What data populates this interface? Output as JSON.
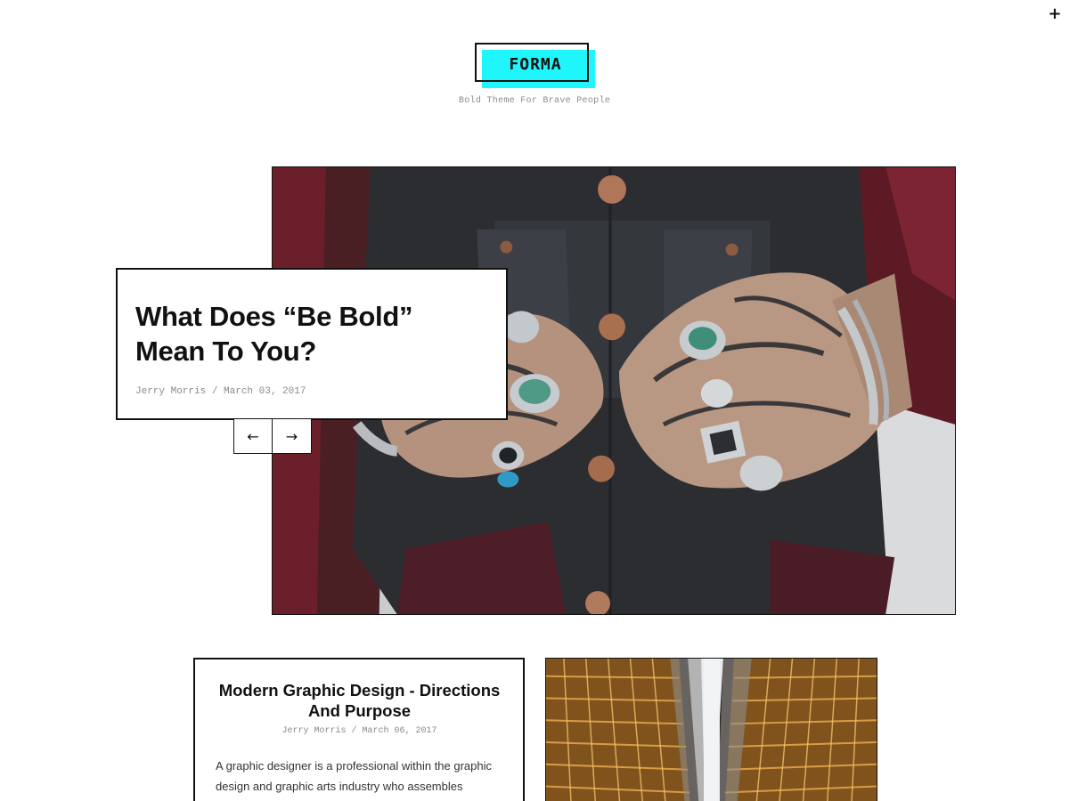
{
  "header": {
    "logo_text": "FORMA",
    "tagline": "Bold Theme For Brave People",
    "menu_icon": "plus-icon"
  },
  "hero": {
    "title": "What Does “Be Bold” Mean To You?",
    "author": "Jerry Morris",
    "separator": "/",
    "date": "March 03, 2017",
    "meta": "Jerry Morris / March 03, 2017",
    "prev_icon": "arrow-left-icon",
    "next_icon": "arrow-right-icon",
    "prev_glyph": "←",
    "next_glyph": "→"
  },
  "posts": [
    {
      "title": "Modern Graphic Design - Directions And Purpose",
      "meta": "Jerry Morris / March 06, 2017",
      "excerpt": "A graphic designer is a professional within the graphic design and graphic arts industry who assembles"
    }
  ],
  "colors": {
    "accent": "#1ff6fb",
    "text": "#111111",
    "muted": "#8a8a8a"
  }
}
